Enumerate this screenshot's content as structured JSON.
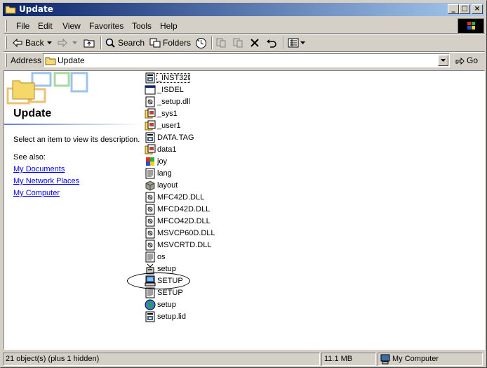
{
  "window": {
    "title": "Update"
  },
  "menu": [
    "File",
    "Edit",
    "View",
    "Favorites",
    "Tools",
    "Help"
  ],
  "toolbar": {
    "back": "Back",
    "search": "Search",
    "folders": "Folders"
  },
  "address": {
    "label": "Address",
    "value": "Update",
    "go": "Go"
  },
  "left_pane": {
    "title": "Update",
    "description": "Select an item to view its description.",
    "see_also": "See also:",
    "links": [
      "My Documents",
      "My Network Places",
      "My Computer"
    ]
  },
  "files": [
    {
      "name": "_INST32I",
      "icon": "exe-icon"
    },
    {
      "name": "_ISDEL",
      "icon": "app-window-icon"
    },
    {
      "name": "_setup.dll",
      "icon": "dll-icon"
    },
    {
      "name": "_sys1",
      "icon": "cab-icon"
    },
    {
      "name": "_user1",
      "icon": "cab-icon"
    },
    {
      "name": "DATA.TAG",
      "icon": "exe-icon"
    },
    {
      "name": "data1",
      "icon": "cab-icon"
    },
    {
      "name": "joy",
      "icon": "windows-flag-icon"
    },
    {
      "name": "lang",
      "icon": "ini-icon"
    },
    {
      "name": "layout",
      "icon": "package-icon"
    },
    {
      "name": "MFC42D.DLL",
      "icon": "dll-icon"
    },
    {
      "name": "MFCD42D.DLL",
      "icon": "dll-icon"
    },
    {
      "name": "MFCO42D.DLL",
      "icon": "dll-icon"
    },
    {
      "name": "MSVCP60D.DLL",
      "icon": "dll-icon"
    },
    {
      "name": "MSVCRTD.DLL",
      "icon": "dll-icon"
    },
    {
      "name": "os",
      "icon": "ini-icon"
    },
    {
      "name": "setup",
      "icon": "setup-box-icon"
    },
    {
      "name": "SETUP",
      "icon": "setup-computer-icon"
    },
    {
      "name": "SETUP",
      "icon": "ini-icon"
    },
    {
      "name": "setup",
      "icon": "globe-icon"
    },
    {
      "name": "setup.lid",
      "icon": "exe-icon"
    }
  ],
  "status": {
    "objects": "21 object(s) (plus 1 hidden)",
    "size": "11.1 MB",
    "zone": "My Computer"
  },
  "colors": {
    "titlebar_start": "#0a246a",
    "titlebar_end": "#a6caf0",
    "face": "#d4d0c8",
    "link": "#0000ff"
  }
}
